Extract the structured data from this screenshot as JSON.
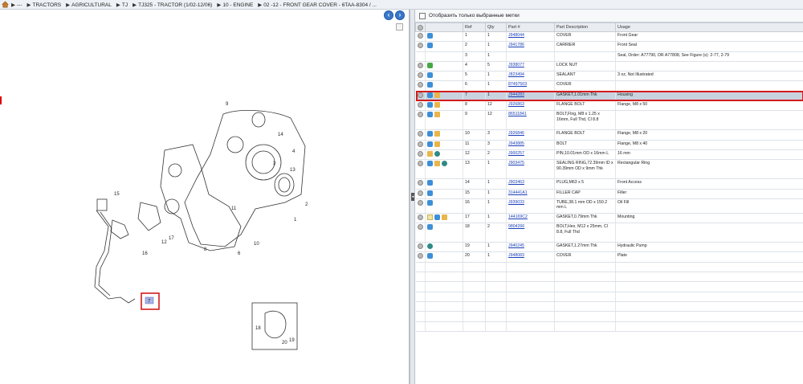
{
  "breadcrumb": [
    "---",
    "TRACTORS",
    "AGRICULTURAL",
    "TJ",
    "TJ325 - TRACTOR (1/02-12/06)",
    "10 - ENGINE",
    "02 -12 - FRONT GEAR COVER - 6TAA-8304 / ..."
  ],
  "filter_label": "Отобразить только выбранные метки",
  "nav": {
    "back": "‹",
    "forward": "›"
  },
  "table": {
    "headers": [
      "",
      "",
      "Ref",
      "Qty",
      "Part #",
      "Part Description",
      "Usage"
    ],
    "rows": [
      {
        "ref": "1",
        "qty": "1",
        "part": "J948044",
        "desc": "COVER",
        "usage": "Front Gear",
        "icons": [
          "gray",
          "blue"
        ],
        "h": "row"
      },
      {
        "ref": "2",
        "qty": "1",
        "part": "J941786",
        "desc": "CARRIER",
        "usage": "Front Seal",
        "icons": [
          "gray",
          "blue"
        ],
        "h": "row"
      },
      {
        "ref": "3",
        "qty": "1",
        "part": "",
        "desc": "",
        "usage": "Seal, Order: A77790, OR A77808, See Figure (s): 2-77, 2-79",
        "icons": [],
        "h": "row"
      },
      {
        "ref": "4",
        "qty": "5",
        "part": "J938077",
        "desc": "LOCK NUT",
        "usage": "",
        "icons": [
          "gray",
          "green"
        ],
        "h": "row"
      },
      {
        "ref": "5",
        "qty": "1",
        "part": "J823494",
        "desc": "SEALANT",
        "usage": "3 oz, Not Illustrated",
        "icons": [
          "gray",
          "blue"
        ],
        "h": "row"
      },
      {
        "ref": "6",
        "qty": "1",
        "part": "87497503",
        "desc": "COVER",
        "usage": "",
        "icons": [
          "gray",
          "blue"
        ],
        "h": "row"
      },
      {
        "ref": "7",
        "qty": "1",
        "part": "J944283",
        "desc": "GASKET,1.01mm Thk",
        "usage": "Housing",
        "icons": [
          "gray",
          "blue",
          "box"
        ],
        "h": "row sel"
      },
      {
        "ref": "8",
        "qty": "12",
        "part": "J926863",
        "desc": "FLANGE BOLT",
        "usage": "Flange, M8 x 50",
        "icons": [
          "gray",
          "blue",
          "box"
        ],
        "h": "row"
      },
      {
        "ref": "9",
        "qty": "12",
        "part": "86511841",
        "desc": "BOLT,Flng, M8 x 1.25 x 16mm, Full Thd, Cl 8.8",
        "usage": "",
        "icons": [
          "gray",
          "blue",
          "box"
        ],
        "h": "row tall"
      },
      {
        "ref": "10",
        "qty": "3",
        "part": "J926846",
        "desc": "FLANGE BOLT",
        "usage": "Flange, M8 x 20",
        "icons": [
          "gray",
          "blue",
          "box"
        ],
        "h": "row"
      },
      {
        "ref": "11",
        "qty": "3",
        "part": "J943885",
        "desc": "BOLT",
        "usage": "Flange, M8 x 40",
        "icons": [
          "gray",
          "blue",
          "box"
        ],
        "h": "row"
      },
      {
        "ref": "12",
        "qty": "2",
        "part": "J900257",
        "desc": "PIN,10.01mm OD x 16mm L",
        "usage": "16 mm",
        "icons": [
          "gray",
          "box",
          "teal"
        ],
        "h": "row"
      },
      {
        "ref": "13",
        "qty": "1",
        "part": "J903475",
        "desc": "SEALING RING,72.39mm ID x 90.39mm OD x 9mm Thk",
        "usage": "Rectangular Ring",
        "icons": [
          "gray",
          "blue",
          "box",
          "teal"
        ],
        "h": "row tall"
      },
      {
        "ref": "14",
        "qty": "1",
        "part": "J903463",
        "desc": "PLUG,M63 x 5",
        "usage": "Front Access",
        "icons": [
          "gray",
          "blue"
        ],
        "h": "row"
      },
      {
        "ref": "15",
        "qty": "1",
        "part": "314441A1",
        "desc": "FILLER CAP",
        "usage": "Filler",
        "icons": [
          "gray",
          "blue"
        ],
        "h": "row"
      },
      {
        "ref": "16",
        "qty": "1",
        "part": "J939033",
        "desc": "TUBE,38.1 mm OD x 150.2 mm L",
        "usage": "Oil Fill",
        "icons": [
          "gray",
          "blue"
        ],
        "h": "row mid"
      },
      {
        "ref": "17",
        "qty": "1",
        "part": "144169C2",
        "desc": "GASKET,0.79mm Thk",
        "usage": "Mounting",
        "icons": [
          "gray",
          "note",
          "blue",
          "box"
        ],
        "h": "row"
      },
      {
        "ref": "18",
        "qty": "2",
        "part": "9804266",
        "desc": "BOLT,Hex, M12 x 25mm, Cl 8.8, Full Thd",
        "usage": "",
        "icons": [
          "gray",
          "blue"
        ],
        "h": "row tall"
      },
      {
        "ref": "19",
        "qty": "1",
        "part": "J940245",
        "desc": "GASKET,1.27mm Thk",
        "usage": "Hydraulic Pump",
        "icons": [
          "gray",
          "teal"
        ],
        "h": "row"
      },
      {
        "ref": "20",
        "qty": "1",
        "part": "J948083",
        "desc": "COVER",
        "usage": "Plate",
        "icons": [
          "gray",
          "blue"
        ],
        "h": "row"
      }
    ]
  },
  "diagram": {
    "callouts": [
      "1",
      "2",
      "3",
      "4",
      "6",
      "8",
      "9",
      "10",
      "11",
      "12",
      "13",
      "14",
      "15",
      "16",
      "17",
      "18",
      "19",
      "20"
    ],
    "selected_callout": "7"
  }
}
